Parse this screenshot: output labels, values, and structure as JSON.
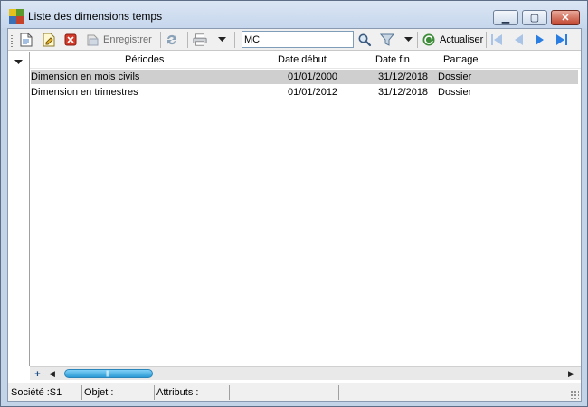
{
  "window": {
    "title": "Liste des dimensions temps",
    "controls": {
      "minimize": "▁",
      "maximize": "▢",
      "close": "✕"
    }
  },
  "toolbar": {
    "save_label": "Enregistrer",
    "search_value": "MC",
    "refresh_label": "Actualiser",
    "icons": [
      "new-doc-icon",
      "edit-doc-icon",
      "delete-icon",
      "save-icon",
      "sync-icon",
      "print-icon",
      "dropdown-arrow-icon",
      "search-icon",
      "filter-icon",
      "refresh-icon",
      "first-page-icon",
      "previous-page-icon",
      "next-page-icon",
      "last-page-icon"
    ]
  },
  "grid": {
    "columns": [
      "Périodes",
      "Date début",
      "Date fin",
      "Partage"
    ],
    "rows": [
      {
        "periode": "Dimension en mois civils",
        "debut": "01/01/2000",
        "fin": "31/12/2018",
        "partage": "Dossier",
        "selected": true
      },
      {
        "periode": "Dimension en trimestres",
        "debut": "01/01/2012",
        "fin": "31/12/2018",
        "partage": "Dossier",
        "selected": false
      }
    ]
  },
  "statusbar": {
    "societe": "Société :S1",
    "objet": "Objet :",
    "attributs": "Attributs :"
  },
  "colors": {
    "window_frame": "#c3d3e8",
    "selection_row": "#cfcfcf",
    "scroll_thumb": "#2c9bd6",
    "nav_arrow": "#2a7de1",
    "close_button": "#c1452f"
  }
}
